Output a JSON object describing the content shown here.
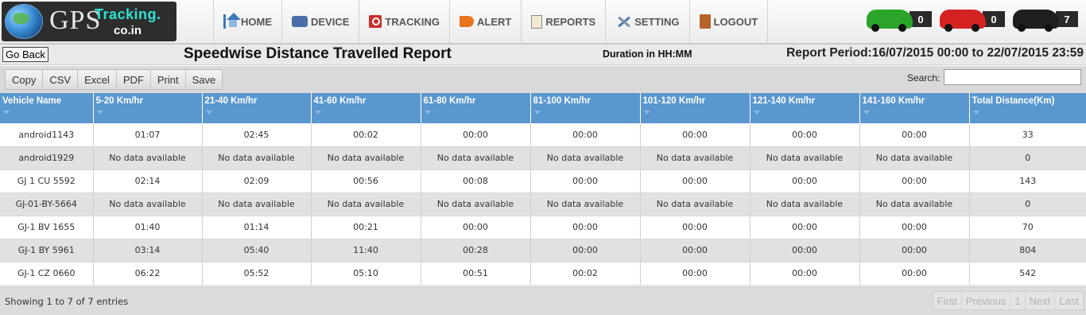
{
  "brand": {
    "gps": "GPS",
    "tracking": "Tracking.",
    "domain": "co.in"
  },
  "nav": {
    "items": [
      {
        "label": "HOME",
        "icon": "home-icon"
      },
      {
        "label": "DEVICE",
        "icon": "device-icon"
      },
      {
        "label": "TRACKING",
        "icon": "tracking-icon"
      },
      {
        "label": "ALERT",
        "icon": "alert-icon"
      },
      {
        "label": "REPORTS",
        "icon": "reports-icon"
      },
      {
        "label": "SETTING",
        "icon": "setting-icon"
      },
      {
        "label": "LOGOUT",
        "icon": "logout-icon"
      }
    ]
  },
  "vehicle_status": [
    {
      "color": "#2aa52a",
      "count": "0"
    },
    {
      "color": "#d42222",
      "count": "0"
    },
    {
      "color": "#1f1f1f",
      "count": "7"
    }
  ],
  "header": {
    "go_back": "Go Back",
    "title": "Speedwise Distance Travelled Report",
    "duration": "Duration in HH:MM",
    "report_period": "Report Period:16/07/2015 00:00 to 22/07/2015 23:59"
  },
  "toolbar": {
    "buttons": [
      "Copy",
      "CSV",
      "Excel",
      "PDF",
      "Print",
      "Save"
    ],
    "search_label": "Search:",
    "search_value": ""
  },
  "table": {
    "columns": [
      "Vehicle Name",
      "5-20 Km/hr",
      "21-40 Km/hr",
      "41-60 Km/hr",
      "61-80 Km/hr",
      "81-100 Km/hr",
      "101-120 Km/hr",
      "121-140 Km/hr",
      "141-160 Km/hr",
      "Total Distance(Km)"
    ],
    "rows": [
      [
        "android1143",
        "01:07",
        "02:45",
        "00:02",
        "00:00",
        "00:00",
        "00:00",
        "00:00",
        "00:00",
        "33"
      ],
      [
        "android1929",
        "No data available",
        "No data available",
        "No data available",
        "No data available",
        "No data available",
        "No data available",
        "No data available",
        "No data available",
        "0"
      ],
      [
        "GJ 1 CU 5592",
        "02:14",
        "02:09",
        "00:56",
        "00:08",
        "00:00",
        "00:00",
        "00:00",
        "00:00",
        "143"
      ],
      [
        "GJ-01-BY-5664",
        "No data available",
        "No data available",
        "No data available",
        "No data available",
        "No data available",
        "No data available",
        "No data available",
        "No data available",
        "0"
      ],
      [
        "GJ-1 BV 1655",
        "01:40",
        "01:14",
        "00:21",
        "00:00",
        "00:00",
        "00:00",
        "00:00",
        "00:00",
        "70"
      ],
      [
        "GJ-1 BY 5961",
        "03:14",
        "05:40",
        "11:40",
        "00:28",
        "00:00",
        "00:00",
        "00:00",
        "00:00",
        "804"
      ],
      [
        "GJ-1 CZ 0660",
        "06:22",
        "05:52",
        "05:10",
        "00:51",
        "00:02",
        "00:00",
        "00:00",
        "00:00",
        "542"
      ]
    ]
  },
  "footer": {
    "showing": "Showing 1 to 7 of 7 entries",
    "pager": [
      "First",
      "Previous",
      "1",
      "Next",
      "Last"
    ]
  }
}
